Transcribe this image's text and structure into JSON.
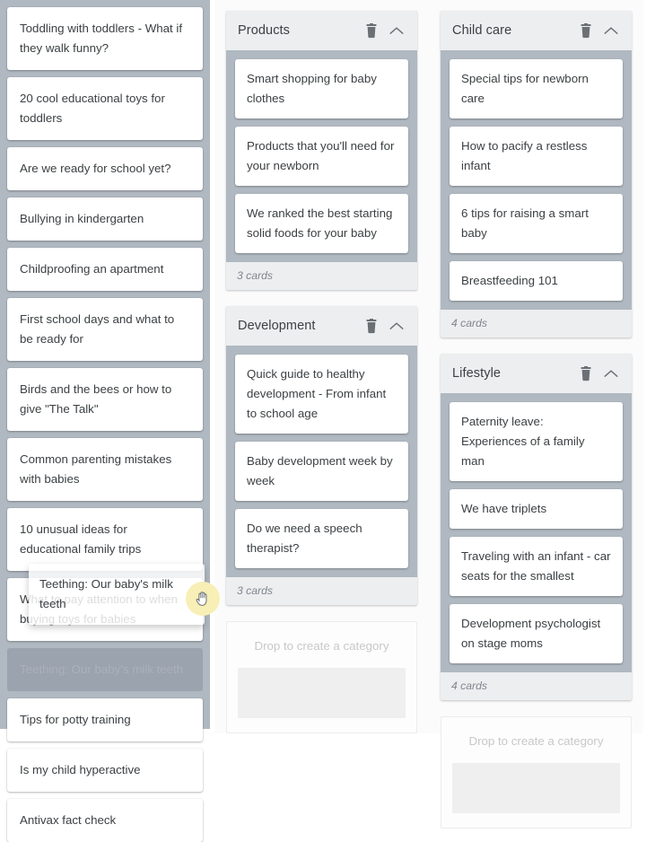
{
  "uncategorized": {
    "name": "uncategorized-column",
    "cards": [
      "Toddling with toddlers - What if they walk funny?",
      "20 cool educational toys for toddlers",
      "Are we ready for school yet?",
      "Bullying in kindergarten",
      "Childproofing an apartment",
      "First school days and what to be ready for",
      "Birds and the bees or how to give \"The Talk\"",
      "Common parenting mistakes with babies",
      "10 unusual ideas for educational family trips",
      "What to pay attention to when buying toys for babies",
      "Teething: Our baby's milk teeth",
      "Tips for potty training",
      "Is my child hyperactive",
      "Antivax fact check"
    ]
  },
  "drag": {
    "ghost_label": "Teething: Our baby's milk teeth",
    "cursor": "grab-hand-cursor"
  },
  "icons": {
    "delete": "trash-icon",
    "collapse": "chevron-up-icon"
  },
  "dropzone": {
    "label": "Drop to create a category"
  },
  "columns": [
    {
      "id": "middle-column",
      "categories": [
        {
          "title": "Products",
          "cards": [
            "Smart shopping for baby clothes",
            "Products that you'll need for your newborn",
            "We ranked the best starting solid foods for your baby"
          ],
          "count_label": "3 cards"
        },
        {
          "title": "Development",
          "cards": [
            "Quick guide to healthy development - From infant to school age",
            "Baby development week by week",
            "Do we need a speech therapist?"
          ],
          "count_label": "3 cards"
        }
      ]
    },
    {
      "id": "right-column",
      "categories": [
        {
          "title": "Child care",
          "cards": [
            "Special tips for newborn care",
            "How to pacify a restless infant",
            "6 tips for raising a smart baby",
            "Breastfeeding 101"
          ],
          "count_label": "4 cards"
        },
        {
          "title": "Lifestyle",
          "cards": [
            "Paternity leave: Experiences of a family man",
            "We have triplets",
            "Traveling with an infant - car seats for the smallest",
            "Development psychologist on stage moms"
          ],
          "count_label": "4 cards"
        }
      ]
    }
  ],
  "colors": {
    "board_background": "#b0b8c1",
    "card_background": "#ffffff",
    "header_background": "#eceef0",
    "text": "#3c4043",
    "muted_text": "#81868c",
    "cursor_highlight": "#f7efb5"
  }
}
